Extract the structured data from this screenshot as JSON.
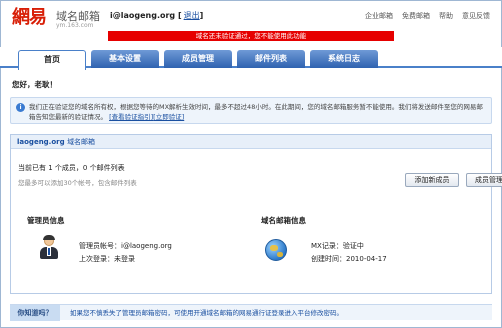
{
  "header": {
    "logo": "網易",
    "brand": "域名邮箱",
    "domain_text": "ym.163.com",
    "account": "i@laogeng.org",
    "logout": "退出",
    "links": [
      "企业邮箱",
      "免费邮箱",
      "帮助",
      "意见反馈"
    ],
    "alert": "域名还未验证通过，您不能使用此功能"
  },
  "tabs": [
    {
      "label": "首页"
    },
    {
      "label": "基本设置"
    },
    {
      "label": "成员管理"
    },
    {
      "label": "邮件列表"
    },
    {
      "label": "系统日志"
    }
  ],
  "greeting": "您好，老耿！",
  "notice": {
    "text": "我们正在验证您的域名所有权，根据您等待的MX解析生效时间，最多不超过48小时。在此期间，您的域名邮箱服务暂不能使用。我们将发送邮件至您的网易邮箱告知您最新的验证情况。",
    "link1": "[查看验证指引]",
    "link2": "[立即验证]"
  },
  "panel": {
    "domain": "laogeng.org",
    "domain_suffix": "域名邮箱",
    "member_line": "当前已有 1 个成员，0 个邮件列表",
    "member_hint": "您最多可以添加30个帐号，包含邮件列表",
    "add_member": "添加新成员",
    "manage_members": "成员管理",
    "admin_title": "管理员信息",
    "admin_account_label": "管理员帐号：",
    "admin_account": "i@laogeng.org",
    "last_login_label": "上次登录：",
    "last_login": "未登录",
    "domain_title": "域名邮箱信息",
    "mx_label": "MX记录：",
    "mx_value": "验证中",
    "created_label": "创建时间：",
    "created_value": "2010-04-17"
  },
  "tip": {
    "label": "你知道吗？",
    "text": "如果您不慎丢失了管理员邮箱密码，可使用开通域名邮箱的网易通行证登录进入平台修改密码。"
  }
}
